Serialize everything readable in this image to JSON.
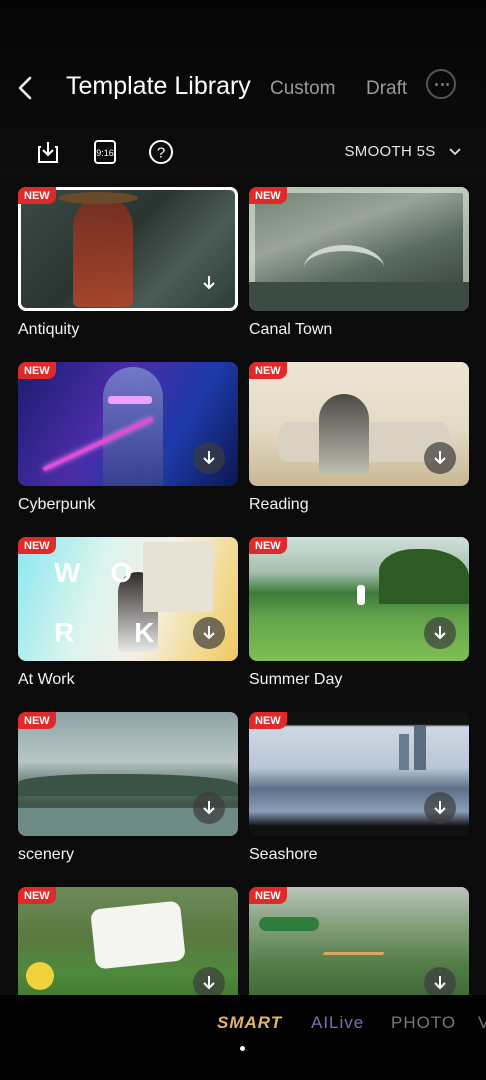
{
  "header": {
    "title": "Template Library",
    "tabs": [
      {
        "label": "Custom"
      },
      {
        "label": "Draft"
      }
    ],
    "speed_selector": "SMOOTH 5S"
  },
  "icons": {
    "back": "chevron-left-icon",
    "download_list": "download-box-icon",
    "ratio": "aspect-ratio-icon",
    "help": "help-circle-icon",
    "more": "more-icon",
    "dropdown": "chevron-down-icon"
  },
  "toolbar": {
    "ratio_label": "9:16",
    "help_glyph": "?"
  },
  "templates": [
    {
      "badge": "NEW",
      "label": "Antiquity",
      "selected": true
    },
    {
      "badge": "NEW",
      "label": "Canal Town"
    },
    {
      "badge": "NEW",
      "label": "Cyberpunk"
    },
    {
      "badge": "NEW",
      "label": "Reading"
    },
    {
      "badge": "NEW",
      "label": "At Work"
    },
    {
      "badge": "NEW",
      "label": "Summer Day"
    },
    {
      "badge": "NEW",
      "label": "scenery"
    },
    {
      "badge": "NEW",
      "label": "Seashore"
    },
    {
      "badge": "NEW",
      "label": ""
    },
    {
      "badge": "NEW",
      "label": ""
    }
  ],
  "camera_modes": [
    {
      "label": "SMART",
      "active": true,
      "color": "#e0b56a"
    },
    {
      "label": "AILive",
      "color": "#6d76b8"
    },
    {
      "label": "PHOTO",
      "color": "#777777"
    },
    {
      "label": "V",
      "color": "#777777"
    }
  ]
}
